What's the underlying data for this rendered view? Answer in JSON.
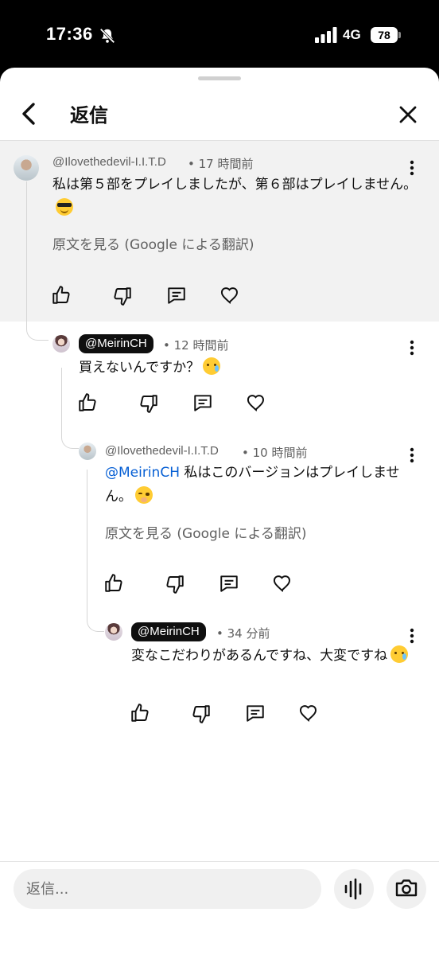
{
  "status_bar": {
    "time": "17:36",
    "network": "4G",
    "battery": "78"
  },
  "header": {
    "title": "返信"
  },
  "comments": [
    {
      "handle": "@Ilovethedevil-I.I.T.D",
      "time": "• 17 時間前",
      "text": "私は第５部をプレイしましたが、第６部はプレイしません。",
      "emoji": "smiling-face-with-sunglasses",
      "translate": "原文を見る (Google による翻訳)"
    },
    {
      "handle": "@MeirinCH",
      "time": "• 12 時間前",
      "text": "買えないんですか？",
      "emoji": "crying-face"
    },
    {
      "handle": "@Ilovethedevil-I.I.T.D",
      "time": "• 10 時間前",
      "mention": "@MeirinCH",
      "text": " 私はこのバージョンはプレイしません。",
      "emoji": "face-with-hand-over-mouth",
      "translate": "原文を見る (Google による翻訳)"
    },
    {
      "handle": "@MeirinCH",
      "time": "• 34 分前",
      "text": "変なこだわりがあるんですね、大変ですね",
      "emoji": "crying-face"
    }
  ],
  "reply_bar": {
    "placeholder": "返信..."
  },
  "icons": {
    "back": "chevron-left-icon",
    "close": "close-icon",
    "more": "more-vert-icon",
    "like": "thumbs-up-icon",
    "dislike": "thumbs-down-icon",
    "reply": "comment-icon",
    "heart": "heart-icon",
    "mic": "voice-icon",
    "camera": "camera-icon"
  },
  "colors": {
    "mention": "#065fd4",
    "highlight": "#f2f2f2",
    "badge": "#0f0f0f"
  }
}
